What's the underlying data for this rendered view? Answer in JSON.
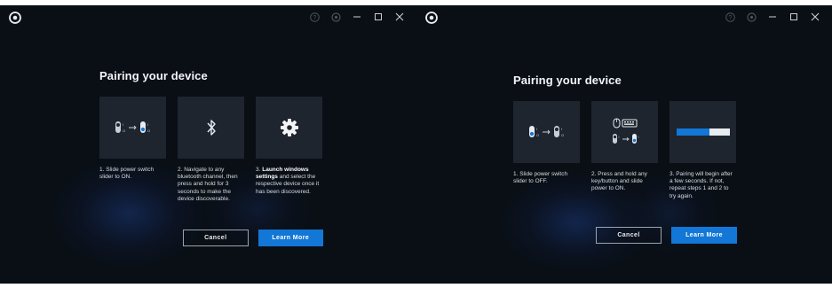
{
  "windows": [
    {
      "title": "Pairing your device",
      "steps": [
        {
          "icon": "slider-on-icon",
          "text": "1. Slide power switch slider to ON."
        },
        {
          "icon": "bluetooth-icon",
          "text": "2. Navigate to any bluetooth channel, then press and hold for 3 seconds to make the device discoverable."
        },
        {
          "icon": "gear-icon",
          "text_bold": "Launch windows settings",
          "text_prefix": "3. ",
          "text_suffix": " and select the respective device once it has been discovered."
        }
      ],
      "cancel_label": "Cancel",
      "learn_more_label": "Learn More"
    },
    {
      "title": "Pairing your device",
      "steps": [
        {
          "icon": "slider-off-icon",
          "text": "1. Slide power switch slider to OFF."
        },
        {
          "icon": "mouse-keyboard-icon",
          "text": "2. Press and hold any key/button and slide power to ON."
        },
        {
          "icon": "progress-bar-icon",
          "text": "3. Pairing will begin after a few seconds. If not, repeat steps 1 and 2 to try again."
        }
      ],
      "cancel_label": "Cancel",
      "learn_more_label": "Learn More"
    }
  ],
  "colors": {
    "window_bg": "#0a0f16",
    "tile_bg": "#1e252e",
    "accent": "#1277d6"
  }
}
